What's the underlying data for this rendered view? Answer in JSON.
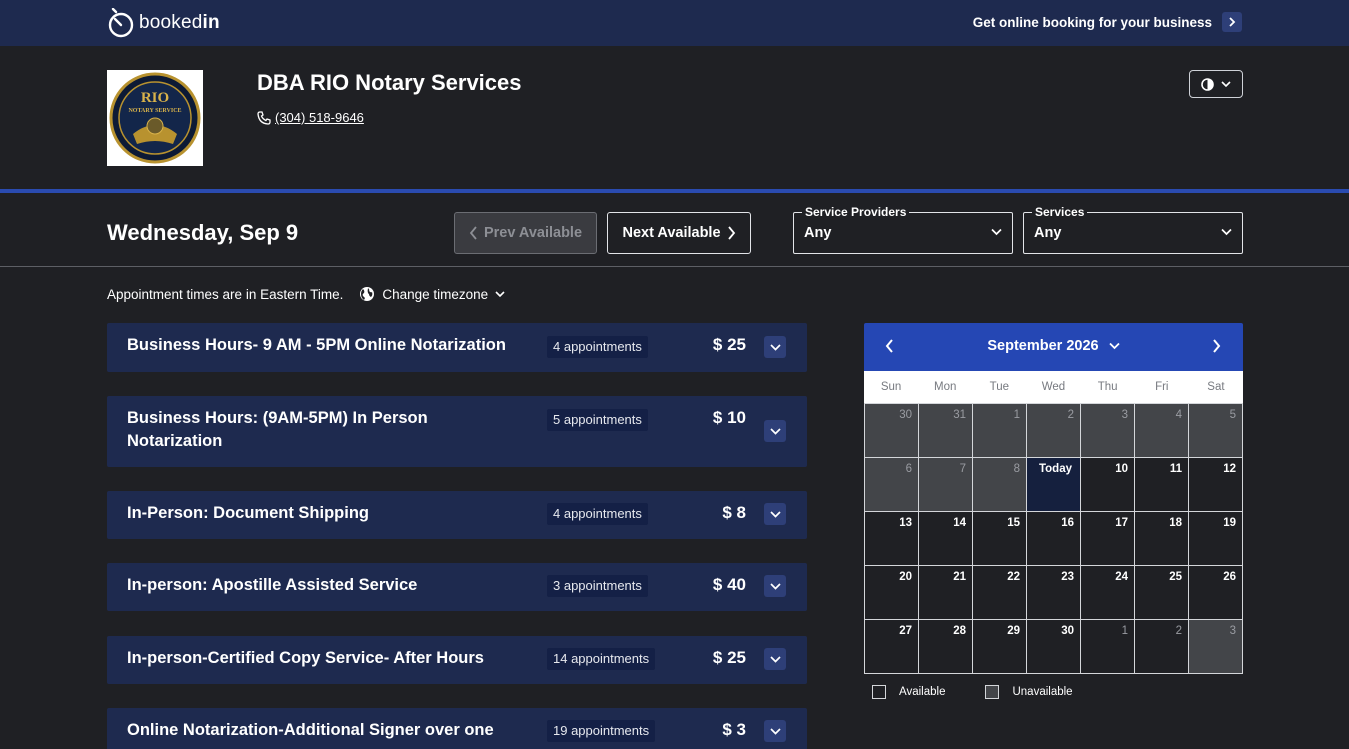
{
  "topbar": {
    "brand_prefix": "booked",
    "brand_suffix": "in",
    "promo_text": "Get online booking for your business"
  },
  "business": {
    "name": "DBA RIO Notary Services",
    "phone": "(304) 518-9646",
    "logo_lines": [
      "RIO",
      "NOTARY SERVICE"
    ]
  },
  "filters": {
    "date_title": "Wednesday, Sep 9",
    "prev_label": "Prev Available",
    "next_label": "Next Available",
    "providers_label": "Service Providers",
    "providers_value": "Any",
    "services_label": "Services",
    "services_value": "Any"
  },
  "timezone": {
    "notice": "Appointment times are in Eastern Time.",
    "change_label": "Change timezone"
  },
  "services": [
    {
      "title_lines": [
        "Business Hours- 9 AM - 5PM Online Notarization"
      ],
      "appointments": "4 appointments",
      "price": "$ 25"
    },
    {
      "title_lines": [
        "Business Hours: (9AM-5PM) In Person",
        "Notarization"
      ],
      "appointments": "5 appointments",
      "price": "$ 10"
    },
    {
      "title_lines": [
        "In-Person: Document Shipping"
      ],
      "appointments": "4 appointments",
      "price": "$ 8"
    },
    {
      "title_lines": [
        "In-person: Apostille Assisted Service"
      ],
      "appointments": "3 appointments",
      "price": "$ 40"
    },
    {
      "title_lines": [
        "In-person-Certified Copy Service- After Hours"
      ],
      "appointments": "14 appointments",
      "price": "$ 25"
    },
    {
      "title_lines": [
        "Online Notarization-Additional Signer over one"
      ],
      "appointments": "19 appointments",
      "price": "$ 3"
    }
  ],
  "calendar": {
    "month_label": "September 2026",
    "weekdays": [
      "Sun",
      "Mon",
      "Tue",
      "Wed",
      "Thu",
      "Fri",
      "Sat"
    ],
    "cells": [
      {
        "label": "30",
        "state": "unavail"
      },
      {
        "label": "31",
        "state": "unavail"
      },
      {
        "label": "1",
        "state": "unavail"
      },
      {
        "label": "2",
        "state": "unavail"
      },
      {
        "label": "3",
        "state": "unavail"
      },
      {
        "label": "4",
        "state": "unavail"
      },
      {
        "label": "5",
        "state": "unavail"
      },
      {
        "label": "6",
        "state": "unavail"
      },
      {
        "label": "7",
        "state": "unavail"
      },
      {
        "label": "8",
        "state": "unavail"
      },
      {
        "label": "Today",
        "state": "today"
      },
      {
        "label": "10",
        "state": "avail"
      },
      {
        "label": "11",
        "state": "avail"
      },
      {
        "label": "12",
        "state": "avail"
      },
      {
        "label": "13",
        "state": "avail"
      },
      {
        "label": "14",
        "state": "avail"
      },
      {
        "label": "15",
        "state": "avail"
      },
      {
        "label": "16",
        "state": "avail"
      },
      {
        "label": "17",
        "state": "avail"
      },
      {
        "label": "18",
        "state": "avail"
      },
      {
        "label": "19",
        "state": "avail"
      },
      {
        "label": "20",
        "state": "avail"
      },
      {
        "label": "21",
        "state": "avail"
      },
      {
        "label": "22",
        "state": "avail"
      },
      {
        "label": "23",
        "state": "avail"
      },
      {
        "label": "24",
        "state": "avail"
      },
      {
        "label": "25",
        "state": "avail"
      },
      {
        "label": "26",
        "state": "avail"
      },
      {
        "label": "27",
        "state": "avail"
      },
      {
        "label": "28",
        "state": "avail"
      },
      {
        "label": "29",
        "state": "avail"
      },
      {
        "label": "30",
        "state": "avail"
      },
      {
        "label": "1",
        "state": "outside"
      },
      {
        "label": "2",
        "state": "outside"
      },
      {
        "label": "3",
        "state": "unavail"
      }
    ],
    "legend_available": "Available",
    "legend_unavailable": "Unavailable"
  },
  "colors": {
    "topbar_bg": "#1e2a4f",
    "page_bg": "#1f2024",
    "accent_blue": "#2547b4",
    "card_bg": "#1e2a4f",
    "unavailable_cell": "#434549"
  }
}
